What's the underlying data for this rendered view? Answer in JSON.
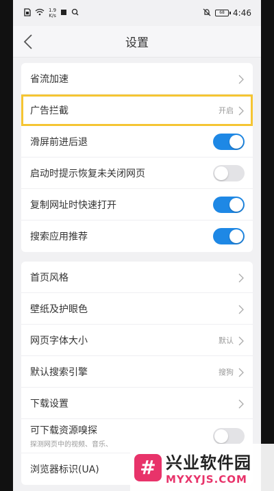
{
  "status_bar": {
    "left_icons": [
      "sim-icon",
      "wifi-icon"
    ],
    "speed_top": "1.9",
    "speed_bottom": "K/s",
    "time": "4:46",
    "battery": "68"
  },
  "header": {
    "title": "设置"
  },
  "group1": [
    {
      "label": "省流加速",
      "type": "link",
      "value": ""
    },
    {
      "label": "广告拦截",
      "type": "link",
      "value": "开启",
      "highlighted": true
    },
    {
      "label": "滑屏前进后退",
      "type": "toggle",
      "on": true
    },
    {
      "label": "启动时提示恢复未关闭网页",
      "type": "toggle",
      "on": false
    },
    {
      "label": "复制网址时快速打开",
      "type": "toggle",
      "on": true
    },
    {
      "label": "搜索应用推荐",
      "type": "toggle",
      "on": true
    }
  ],
  "group2": [
    {
      "label": "首页风格",
      "type": "link",
      "value": ""
    },
    {
      "label": "壁纸及护眼色",
      "type": "link",
      "value": ""
    },
    {
      "label": "网页字体大小",
      "type": "link",
      "value": "默认"
    },
    {
      "label": "默认搜索引擎",
      "type": "link",
      "value": "搜狗"
    },
    {
      "label": "下载设置",
      "type": "link",
      "value": ""
    },
    {
      "label": "可下载资源嗅探",
      "sublabel": "探测网页中的视频、音乐、",
      "type": "toggle",
      "on": false
    },
    {
      "label": "浏览器标识(UA)",
      "type": "link",
      "value": ""
    }
  ],
  "watermark": {
    "logo": "#",
    "cn": "兴业软件园",
    "en": "MYXYJS.COM"
  },
  "colors": {
    "toggle_on": "#1e88e5",
    "highlight": "#f5c532",
    "watermark_accent": "#e8336a"
  }
}
